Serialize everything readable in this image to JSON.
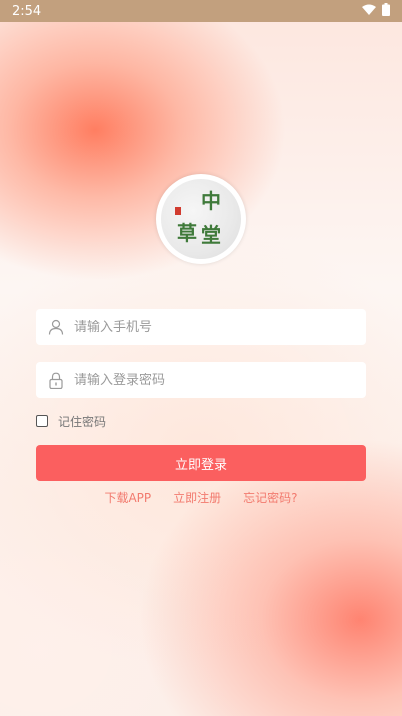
{
  "status_bar": {
    "time": "2:54",
    "wifi_icon": "wifi-icon",
    "battery_icon": "battery-icon"
  },
  "logo": {
    "chars": [
      "中",
      "草",
      "堂"
    ],
    "seal_color": "#d13b2f",
    "char_color": "#3f7a3a"
  },
  "login_form": {
    "phone_placeholder": "请输入手机号",
    "phone_value": "",
    "password_placeholder": "请输入登录密码",
    "password_value": "",
    "remember_label": "记住密码",
    "remember_checked": false,
    "login_button_label": "立即登录"
  },
  "links": {
    "download": "下载APP",
    "register": "立即注册",
    "forgot": "忘记密码?"
  },
  "colors": {
    "accent": "#fb5f5f",
    "link": "#f27a6e",
    "status_bar": "#c2a07e"
  }
}
